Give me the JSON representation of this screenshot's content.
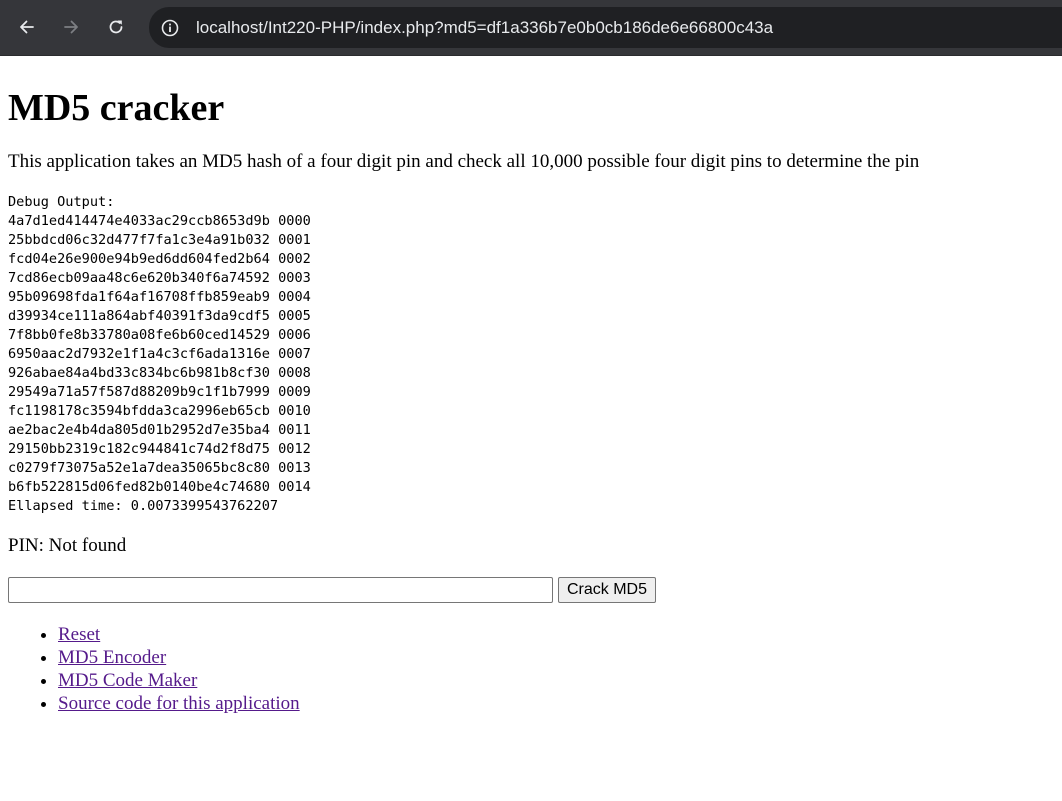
{
  "browser": {
    "url": "localhost/Int220-PHP/index.php?md5=df1a336b7e0b0cb186de6e66800c43a",
    "colors": {
      "toolbar": "#35363a",
      "omnibox": "#1f2023",
      "url_text": "#e8eaed"
    },
    "icons": [
      "back-arrow-icon",
      "forward-arrow-icon",
      "reload-icon",
      "info-icon"
    ]
  },
  "page": {
    "title": "MD5 cracker",
    "description": "This application takes an MD5 hash of a four digit pin and check all 10,000 possible four digit pins to determine the pin",
    "debug": {
      "header": "Debug Output:",
      "rows": [
        "4a7d1ed414474e4033ac29ccb8653d9b 0000",
        "25bbdcd06c32d477f7fa1c3e4a91b032 0001",
        "fcd04e26e900e94b9ed6dd604fed2b64 0002",
        "7cd86ecb09aa48c6e620b340f6a74592 0003",
        "95b09698fda1f64af16708ffb859eab9 0004",
        "d39934ce111a864abf40391f3da9cdf5 0005",
        "7f8bb0fe8b33780a08fe6b60ced14529 0006",
        "6950aac2d7932e1f1a4c3cf6ada1316e 0007",
        "926abae84a4bd33c834bc6b981b8cf30 0008",
        "29549a71a57f587d88209b9c1f1b7999 0009",
        "fc1198178c3594bfdda3ca2996eb65cb 0010",
        "ae2bac2e4b4da805d01b2952d7e35ba4 0011",
        "29150bb2319c182c944841c74d2f8d75 0012",
        "c0279f73075a52e1a7dea35065bc8c80 0013",
        "b6fb522815d06fed82b0140be4c74680 0014"
      ],
      "elapsed": "Ellapsed time: 0.0073399543762207"
    },
    "pin_result": "PIN: Not found",
    "form": {
      "input_value": "",
      "submit_label": "Crack MD5"
    },
    "links": [
      "Reset",
      "MD5 Encoder",
      "MD5 Code Maker",
      "Source code for this application"
    ],
    "colors": {
      "visited_link": "#551a8b"
    }
  }
}
